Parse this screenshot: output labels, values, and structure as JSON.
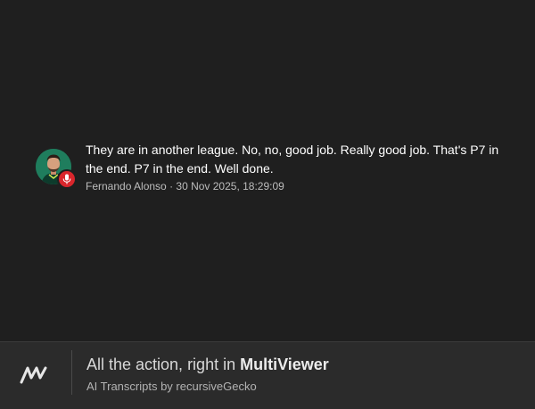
{
  "transcript": {
    "text": "They are in another league. No, no, good job. Really good job. That's P7 in the end. P7 in the end. Well done.",
    "speaker": "Fernando Alonso",
    "separator": " · ",
    "timestamp": "30 Nov 2025, 18:29:09",
    "avatar_icon": "driver-avatar",
    "badge_icon": "microphone-icon",
    "badge_color": "#d9262c"
  },
  "footer": {
    "tagline_prefix": "All the action, right in ",
    "brand": "MultiViewer",
    "credit": "AI Transcripts by recursiveGecko",
    "logo_icon": "multiviewer-logo"
  }
}
